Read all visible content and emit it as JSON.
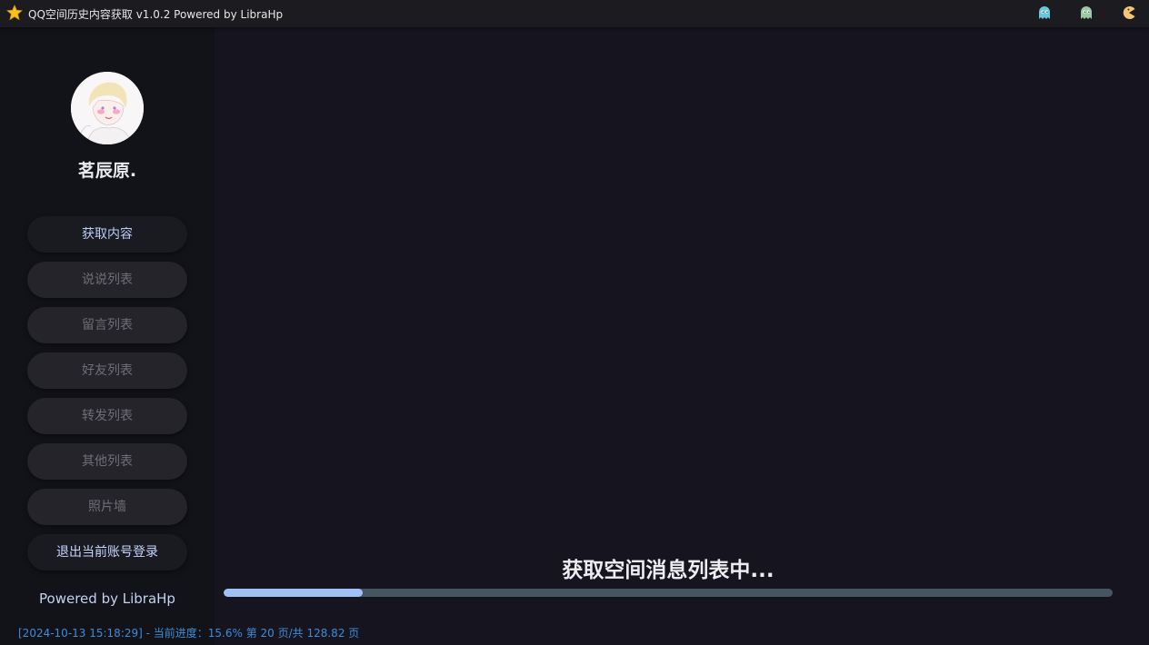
{
  "window": {
    "title": "QQ空间历史内容获取 v1.0.2 Powered by LibraHp"
  },
  "titlebar_icons": [
    "star-icon",
    "ghost-blue-icon",
    "ghost-green-icon",
    "pacman-icon"
  ],
  "profile": {
    "username": "茗辰原."
  },
  "nav": {
    "fetch": "获取内容",
    "shuoshuo": "说说列表",
    "messages": "留言列表",
    "friends": "好友列表",
    "forwards": "转发列表",
    "others": "其他列表",
    "photo_wall": "照片墙",
    "logout": "退出当前账号登录"
  },
  "sidebar_footer": "Powered by LibraHp",
  "status": {
    "title": "获取空间消息列表中...",
    "progress_fraction": 0.156
  },
  "log": {
    "line": "[2024-10-13 15:18:29] - 当前进度：15.6% 第 20 页/共 128.82 页"
  },
  "colors": {
    "accent": "#9fc1f5",
    "progress_track": "#465562",
    "log_text": "#3f8cd6"
  }
}
